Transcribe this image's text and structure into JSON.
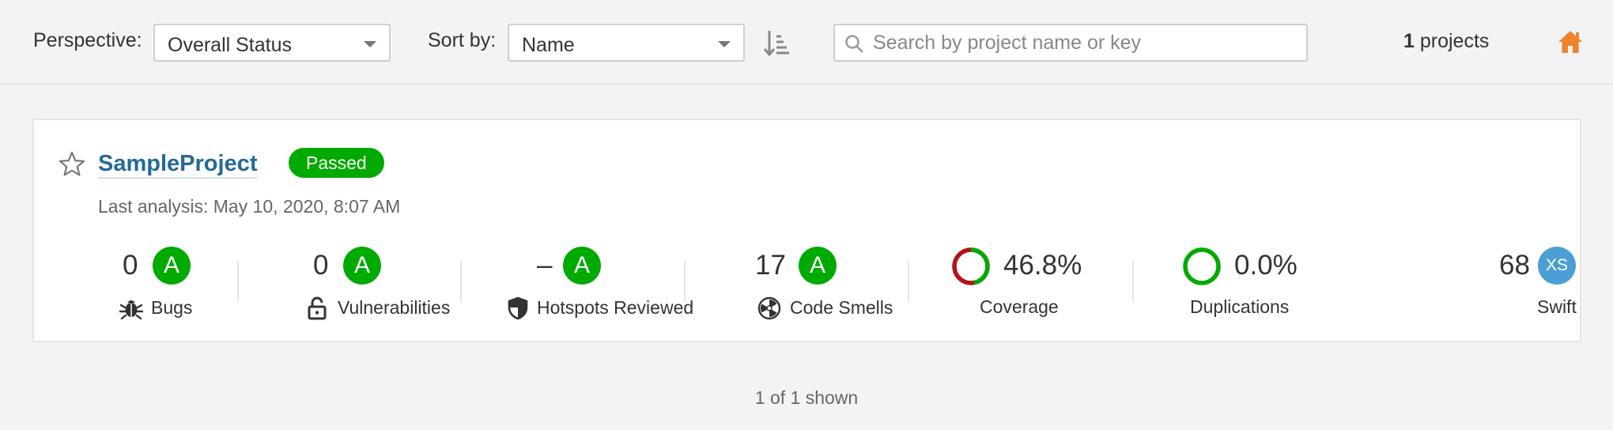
{
  "toolbar": {
    "perspective_label": "Perspective:",
    "perspective_value": "Overall Status",
    "sort_label": "Sort by:",
    "sort_value": "Name",
    "search_placeholder": "Search by project name or key",
    "count_number": "1",
    "count_suffix": " projects"
  },
  "project": {
    "name": "SampleProject",
    "quality_gate": "Passed",
    "last_analysis": "Last analysis: May 10, 2020, 8:07 AM",
    "measures": {
      "bugs": {
        "value": "0",
        "rating": "A",
        "label": "Bugs"
      },
      "vulnerabilities": {
        "value": "0",
        "rating": "A",
        "label": "Vulnerabilities"
      },
      "hotspots": {
        "value": "–",
        "rating": "A",
        "label": "Hotspots Reviewed"
      },
      "code_smells": {
        "value": "17",
        "rating": "A",
        "label": "Code Smells"
      },
      "coverage": {
        "value": "46.8%",
        "percent": 46.8,
        "label": "Coverage"
      },
      "duplications": {
        "value": "0.0%",
        "percent": 0.0,
        "label": "Duplications"
      },
      "size": {
        "value": "68",
        "badge": "XS",
        "label": "Swift"
      }
    }
  },
  "footer": {
    "shown": "1 of 1 shown"
  },
  "colors": {
    "passed": "#00aa00",
    "link": "#236a97",
    "coverage_covered": "#00aa00",
    "coverage_uncovered": "#b0151c",
    "size_badge": "#4b9fd5",
    "home": "#f0822b"
  }
}
